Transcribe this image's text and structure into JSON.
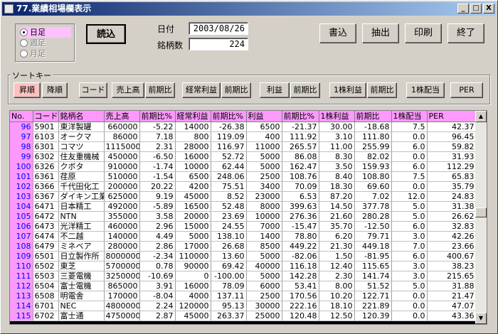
{
  "window": {
    "title": "77.業績相場欄表示",
    "min": "_",
    "max": "□",
    "close": "X"
  },
  "period": {
    "options": [
      "日足",
      "週足",
      "月足"
    ],
    "selected": 0
  },
  "load_button": "読込",
  "date": {
    "label": "日付",
    "value": "2003/08/26"
  },
  "count": {
    "label": "銘柄数",
    "value": "224"
  },
  "actions": [
    "書込",
    "抽出",
    "印刷",
    "終了"
  ],
  "sort": {
    "label": "ソートキー",
    "order": [
      "昇順",
      "降順"
    ],
    "keys": [
      "コード",
      "売上高",
      "前期比",
      "経常利益",
      "前期比",
      "利益",
      "前期比",
      "1株利益",
      "前期比",
      "1株配当",
      "PER"
    ]
  },
  "table": {
    "columns": [
      "No.",
      "コード",
      "銘柄名",
      "売上高",
      "前期比%",
      "経常利益",
      "前期比%",
      "利益",
      "前期比%",
      "1株利益",
      "前期比",
      "1株配当",
      "PER"
    ],
    "rows": [
      [
        "96",
        "5901",
        "東洋製罐",
        "660000",
        "-5.22",
        "14000",
        "-26.38",
        "6500",
        "-21.37",
        "30.00",
        "-18.68",
        "7.5",
        "42.37"
      ],
      [
        "97",
        "6103",
        "オークマ",
        "86000",
        "7.18",
        "800",
        "119.09",
        "400",
        "111.92",
        "3.10",
        "111.80",
        "0.0",
        "96.45"
      ],
      [
        "98",
        "6301",
        "コマツ",
        "1115000",
        "2.31",
        "28000",
        "116.97",
        "11000",
        "265.57",
        "11.00",
        "255.99",
        "6.0",
        "59.82"
      ],
      [
        "99",
        "6302",
        "住友重機械",
        "450000",
        "-6.50",
        "16000",
        "52.72",
        "5000",
        "86.08",
        "8.30",
        "82.02",
        "0.0",
        "31.93"
      ],
      [
        "100",
        "6326",
        "クボタ",
        "910000",
        "-1.74",
        "10000",
        "62.44",
        "5000",
        "162.47",
        "3.50",
        "159.93",
        "6.0",
        "112.29"
      ],
      [
        "101",
        "6361",
        "荏原",
        "510000",
        "-1.54",
        "6500",
        "248.06",
        "2500",
        "108.76",
        "8.40",
        "108.80",
        "7.5",
        "65.83"
      ],
      [
        "102",
        "6366",
        "千代田化工",
        "200000",
        "20.22",
        "4200",
        "75.51",
        "3400",
        "70.09",
        "18.30",
        "69.60",
        "0.0",
        "35.79"
      ],
      [
        "103",
        "6367",
        "ダイキン工業",
        "625000",
        "9.19",
        "45000",
        "8.52",
        "23000",
        "6.53",
        "87.20",
        "7.02",
        "12.0",
        "24.83"
      ],
      [
        "104",
        "6471",
        "日本精工",
        "492000",
        "-5.89",
        "16500",
        "52.48",
        "8000",
        "399.63",
        "14.50",
        "377.78",
        "5.0",
        "31.38"
      ],
      [
        "105",
        "6472",
        "NTN",
        "355000",
        "3.58",
        "20000",
        "23.69",
        "10000",
        "276.36",
        "21.60",
        "280.28",
        "5.0",
        "26.62"
      ],
      [
        "106",
        "6473",
        "光洋精工",
        "460000",
        "2.96",
        "15000",
        "24.55",
        "7000",
        "-15.47",
        "35.70",
        "-12.50",
        "6.0",
        "32.83"
      ],
      [
        "107",
        "6474",
        "不二越",
        "140000",
        "4.49",
        "5000",
        "138.10",
        "1400",
        "78.80",
        "6.20",
        "79.71",
        "3.0",
        "42.26"
      ],
      [
        "108",
        "6479",
        "ミネベア",
        "280000",
        "2.86",
        "17000",
        "26.68",
        "8500",
        "449.22",
        "21.30",
        "449.18",
        "7.0",
        "23.66"
      ],
      [
        "109",
        "6501",
        "日立製作所",
        "8000000",
        "-2.34",
        "110000",
        "13.60",
        "5000",
        "-82.06",
        "1.50",
        "-81.95",
        "6.0",
        "400.67"
      ],
      [
        "110",
        "6502",
        "東芝",
        "5700000",
        "0.78",
        "90000",
        "69.42",
        "40000",
        "116.18",
        "12.40",
        "115.65",
        "3.0",
        "38.23"
      ],
      [
        "111",
        "6503",
        "三菱電機",
        "3250000",
        "-10.69",
        "0",
        "-100.00",
        "5000",
        "142.28",
        "2.30",
        "141.74",
        "3.0",
        "215.65"
      ],
      [
        "112",
        "6504",
        "富士電機",
        "865000",
        "3.91",
        "16000",
        "78.09",
        "6000",
        "53.41",
        "8.00",
        "51.52",
        "5.0",
        "31.88"
      ],
      [
        "113",
        "6508",
        "明電舎",
        "170000",
        "-8.04",
        "4000",
        "137.11",
        "2500",
        "170.56",
        "10.20",
        "122.71",
        "0.0",
        "21.47"
      ],
      [
        "114",
        "6701",
        "NEC",
        "4800000",
        "2.24",
        "120000",
        "95.13",
        "30000",
        "222.16",
        "18.10",
        "221.89",
        "0.0",
        "47.07"
      ],
      [
        "115",
        "6702",
        "富士通",
        "4750000",
        "2.87",
        "45000",
        "263.37",
        "25000",
        "120.48",
        "12.50",
        "120.39",
        "0.0",
        "43.36"
      ]
    ]
  },
  "scrollbar": {
    "up": "▲",
    "down": "▼"
  }
}
